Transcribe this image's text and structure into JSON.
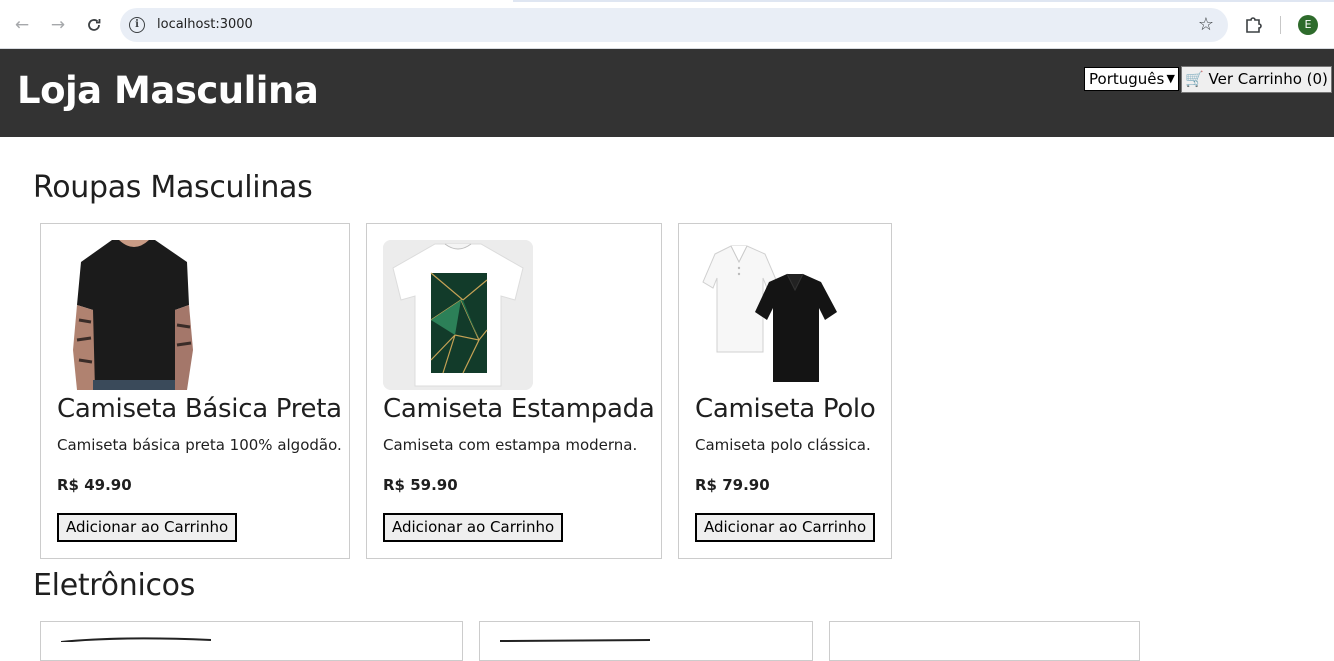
{
  "browser": {
    "url": "localhost:3000",
    "profile_initial": "E",
    "icons": {
      "back": "arrow-left-icon",
      "forward": "arrow-right-icon",
      "reload": "reload-icon",
      "site_info": "info-icon",
      "bookmark": "star-icon",
      "extensions": "puzzle-icon"
    }
  },
  "header": {
    "title": "Loja Masculina",
    "language": "Português",
    "cart_button": "🛒 Ver Carrinho (0)",
    "background": "#333333"
  },
  "sections": [
    {
      "title": "Roupas Masculinas",
      "products": [
        {
          "name": "Camiseta Básica Preta",
          "description": "Camiseta básica preta 100% algodão.",
          "price": "R$ 49.90",
          "button": "Adicionar ao Carrinho"
        },
        {
          "name": "Camiseta Estampada",
          "description": "Camiseta com estampa moderna.",
          "price": "R$ 59.90",
          "button": "Adicionar ao Carrinho"
        },
        {
          "name": "Camiseta Polo",
          "description": "Camiseta polo clássica.",
          "price": "R$ 79.90",
          "button": "Adicionar ao Carrinho"
        }
      ]
    },
    {
      "title": "Eletrônicos"
    }
  ]
}
